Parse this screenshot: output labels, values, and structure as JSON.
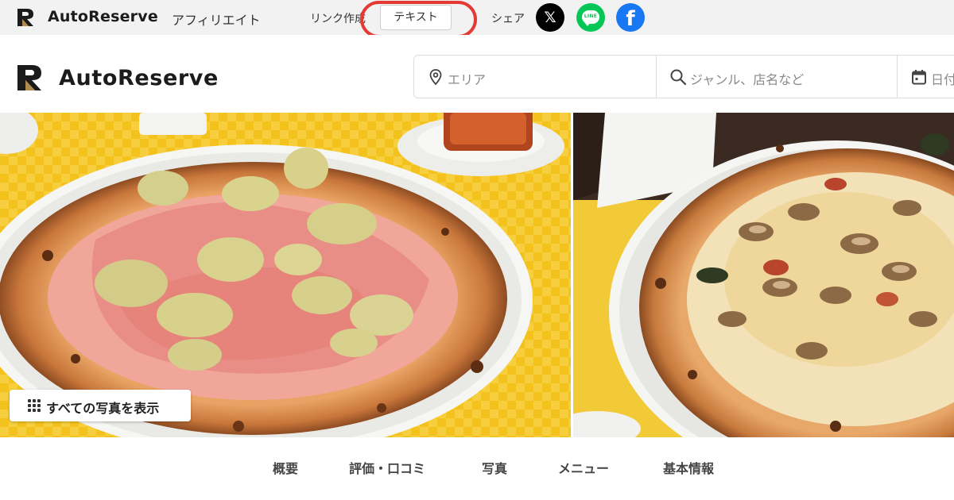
{
  "affiliate_bar": {
    "brand": "AutoReserve",
    "subtitle": "アフィリエイト",
    "link_label": "リンク作成",
    "text_button": "テキスト",
    "share_label": "シェア",
    "share_icons": [
      "x-icon",
      "line-icon",
      "facebook-icon"
    ],
    "x_glyph": "𝕏",
    "line_glyph": "LINE",
    "facebook_glyph": "f"
  },
  "header": {
    "brand": "AutoReserve",
    "search": {
      "area_placeholder": "エリア",
      "genre_placeholder": "ジャンル、店名など",
      "date_placeholder": "日付"
    }
  },
  "gallery": {
    "show_all_label": "すべての写真を表示"
  },
  "tabs": [
    {
      "label": "概要"
    },
    {
      "label": "評価・口コミ"
    },
    {
      "label": "写真"
    },
    {
      "label": "メニュー"
    },
    {
      "label": "基本情報"
    }
  ],
  "colors": {
    "highlight": "#e53935",
    "line_green": "#06c755",
    "facebook_blue": "#1877f2",
    "logo_gold": "#b08a4f",
    "logo_dark": "#1b1b1b"
  }
}
